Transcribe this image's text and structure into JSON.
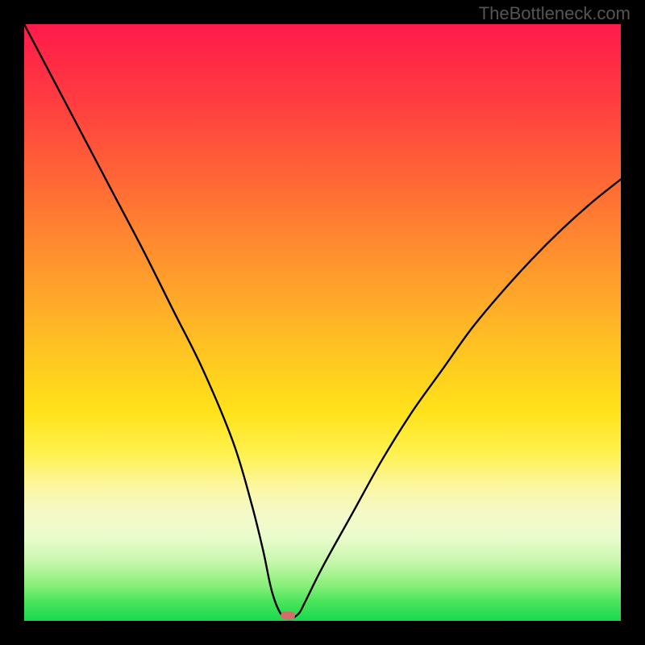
{
  "watermark": "TheBottleneck.com",
  "chart_data": {
    "type": "line",
    "title": "",
    "xlabel": "",
    "ylabel": "",
    "xlim": [
      0,
      100
    ],
    "ylim": [
      0,
      100
    ],
    "grid": false,
    "legend": false,
    "background": "rainbow-gradient (red top → green bottom)",
    "series": [
      {
        "name": "bottleneck-curve",
        "x": [
          0,
          5,
          10,
          15,
          20,
          25,
          30,
          35,
          38,
          40,
          41.5,
          43,
          44.5,
          46,
          47,
          50,
          55,
          60,
          65,
          70,
          75,
          80,
          85,
          90,
          95,
          100
        ],
        "values": [
          100,
          90.5,
          81,
          71.5,
          62,
          52,
          42,
          30,
          20,
          12,
          5,
          1.2,
          0.4,
          1.2,
          3,
          9,
          18,
          27,
          35,
          42,
          49,
          55,
          60.5,
          65.5,
          70,
          74
        ]
      }
    ],
    "marker": {
      "shape": "rounded-rect",
      "x": 44.2,
      "y": 0.9,
      "color": "#d86b6c"
    }
  }
}
